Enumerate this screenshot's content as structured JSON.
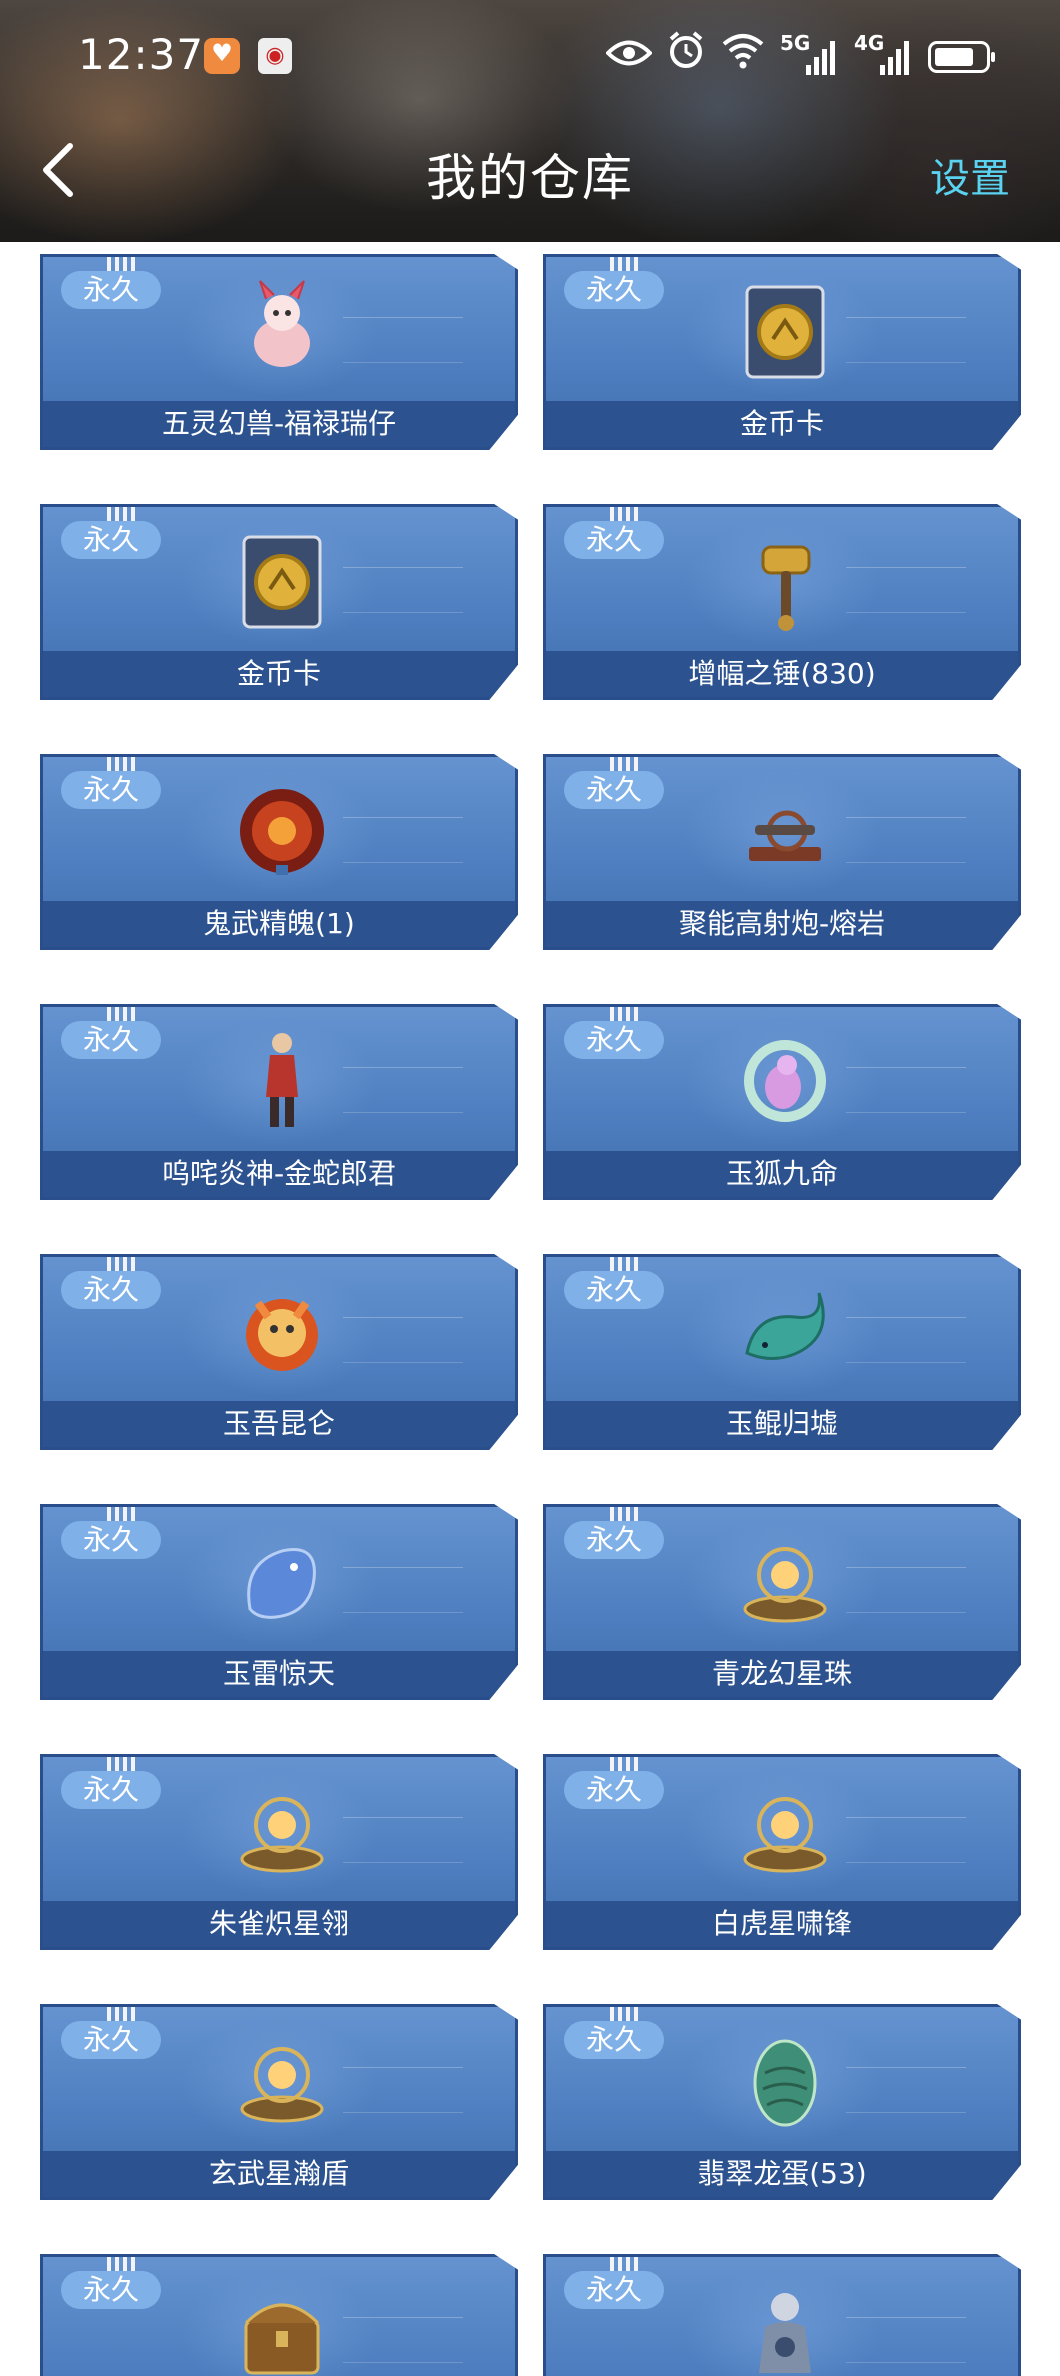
{
  "status_bar": {
    "time": "12:37",
    "network_label_1": "5G",
    "network_label_2": "4G"
  },
  "nav": {
    "title": "我的仓库",
    "settings_label": "设置"
  },
  "items": [
    {
      "badge": "永久",
      "name": "五灵幻兽-福禄瑞仔",
      "icon": "pet-creature-icon"
    },
    {
      "badge": "永久",
      "name": "金币卡",
      "icon": "gold-coin-card-icon"
    },
    {
      "badge": "永久",
      "name": "金币卡",
      "icon": "gold-coin-card-icon"
    },
    {
      "badge": "永久",
      "name": "增幅之锤(830)",
      "icon": "hammer-icon"
    },
    {
      "badge": "永久",
      "name": "鬼武精魄(1)",
      "icon": "red-orb-icon"
    },
    {
      "badge": "永久",
      "name": "聚能高射炮-熔岩",
      "icon": "cannon-icon"
    },
    {
      "badge": "永久",
      "name": "呜咤炎神-金蛇郎君",
      "icon": "character-icon"
    },
    {
      "badge": "永久",
      "name": "玉狐九命",
      "icon": "jade-fox-icon"
    },
    {
      "badge": "永久",
      "name": "玉吾昆仑",
      "icon": "fire-beast-icon"
    },
    {
      "badge": "永久",
      "name": "玉鲲归墟",
      "icon": "jade-whale-icon"
    },
    {
      "badge": "永久",
      "name": "玉雷惊天",
      "icon": "jade-dragon-icon"
    },
    {
      "badge": "永久",
      "name": "青龙幻星珠",
      "icon": "star-orb-icon"
    },
    {
      "badge": "永久",
      "name": "朱雀炽星翎",
      "icon": "star-orb-icon"
    },
    {
      "badge": "永久",
      "name": "白虎星啸锋",
      "icon": "star-orb-icon"
    },
    {
      "badge": "永久",
      "name": "玄武星瀚盾",
      "icon": "star-orb-icon"
    },
    {
      "badge": "永久",
      "name": "翡翠龙蛋(53)",
      "icon": "dragon-egg-icon"
    },
    {
      "badge": "永久",
      "name": "",
      "icon": "treasure-chest-icon"
    },
    {
      "badge": "永久",
      "name": "",
      "icon": "figurine-icon"
    }
  ],
  "colors": {
    "card_blue": "#5686c6",
    "name_bar": "#2c538f",
    "badge": "#7fb0e8",
    "settings": "#5ad3f0"
  }
}
